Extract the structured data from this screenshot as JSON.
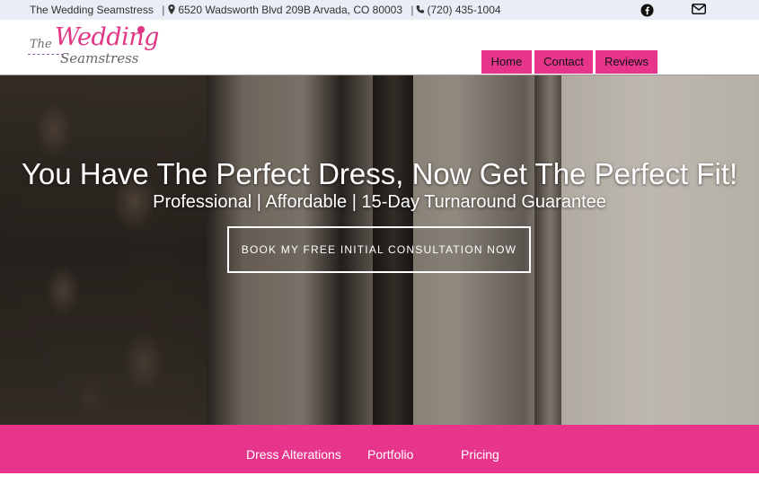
{
  "topbar": {
    "business_name": "The Wedding Seamstress",
    "address": "6520 Wadsworth Blvd 209B Arvada, CO 80003",
    "phone": "(720) 435-1004",
    "facebook_icon": "facebook-icon",
    "email_icon": "envelope-icon"
  },
  "logo": {
    "the": "The",
    "wedding": "Wedding",
    "seamstress": "Seamstress"
  },
  "nav": {
    "items": [
      {
        "label": "Home"
      },
      {
        "label": "Contact"
      },
      {
        "label": "Reviews"
      }
    ]
  },
  "hero": {
    "title": "You Have The Perfect Dress, Now Get The Perfect Fit!",
    "subtitle": "Professional | Affordable | 15-Day Turnaround Guarantee",
    "cta_label": "BOOK MY FREE INITIAL CONSULTATION NOW"
  },
  "subnav": {
    "items": [
      {
        "label": "Dress Alterations"
      },
      {
        "label": "Portfolio"
      },
      {
        "label": "Pricing"
      }
    ]
  },
  "colors": {
    "brand_pink": "#e6358a",
    "topbar_bg": "#e9edf5"
  }
}
